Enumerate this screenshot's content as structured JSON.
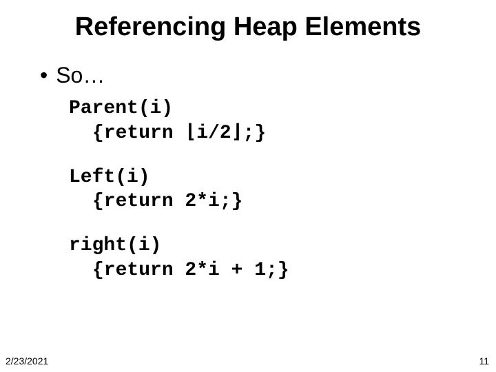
{
  "title": "Referencing Heap Elements",
  "bullet": {
    "mark": "•",
    "text": "So…"
  },
  "code": {
    "parent": {
      "sig": "Parent(i)",
      "body": "{return ⌊i/2⌋;}"
    },
    "left": {
      "sig": "Left(i)",
      "body": "{return 2*i;}"
    },
    "right": {
      "sig": "right(i)",
      "body": "{return 2*i + 1;}"
    }
  },
  "footer": {
    "date": "2/23/2021",
    "page": "11"
  }
}
